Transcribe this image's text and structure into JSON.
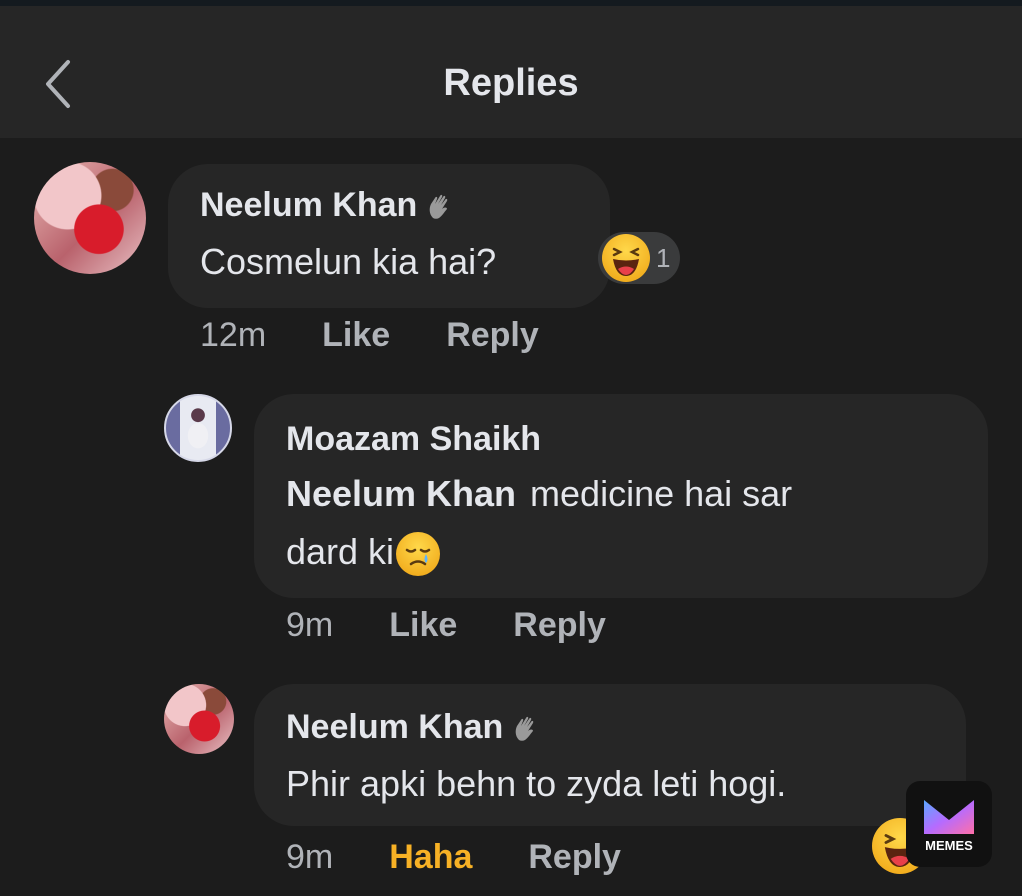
{
  "header": {
    "title": "Replies",
    "back_icon": "chevron-left-icon"
  },
  "comments": [
    {
      "author": "Neelum Khan",
      "text": "Cosmelun kia hai?",
      "time": "12m",
      "like_label": "Like",
      "reply_label": "Reply",
      "reaction": {
        "icon": "haha-emoji-icon",
        "count": "1"
      }
    },
    {
      "author": "Moazam Shaikh",
      "mention": "Neelum Khan",
      "text_line1": "medicine hai sar",
      "text_line2": "dard ki",
      "text_emoji": "sad-tear-emoji-icon",
      "time": "9m",
      "like_label": "Like",
      "reply_label": "Reply"
    },
    {
      "author": "Neelum Khan",
      "text": "Phir apki behn to zyda leti hogi.",
      "time": "9m",
      "reaction_label": "Haha",
      "reply_label": "Reply",
      "reaction": {
        "icon": "haha-emoji-icon"
      }
    }
  ],
  "watermark": {
    "label": "MEMES"
  },
  "colors": {
    "background": "#1c1c1c",
    "bubble": "#262626",
    "text": "#e4e6eb",
    "meta": "#b0b3b8",
    "haha": "#f7b125"
  }
}
